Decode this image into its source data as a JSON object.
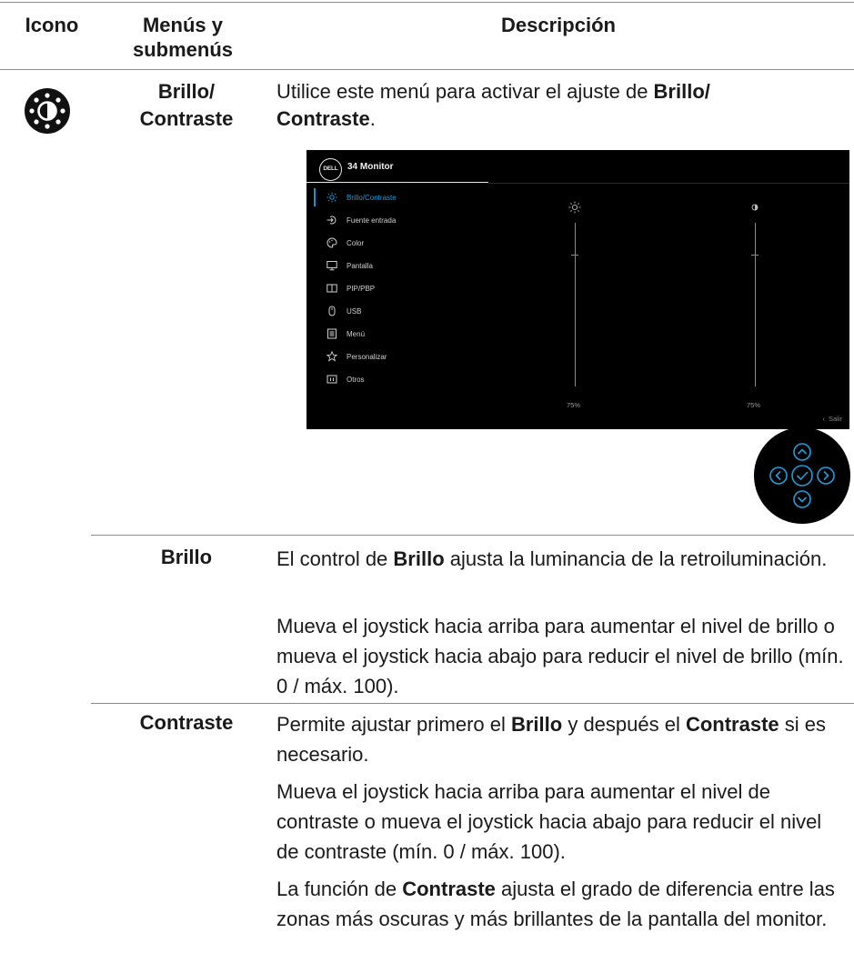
{
  "header": {
    "icon_col": "Icono",
    "menu_col_line1": "Menús y",
    "menu_col_line2": "submenús",
    "desc_col": "Descripción"
  },
  "section": {
    "icon": "brightness-contrast-icon",
    "menu_line1": "Brillo/",
    "menu_line2": "Contraste",
    "intro_pre": "Utilice este menú para activar el ajuste de ",
    "intro_bold1": "Brillo/",
    "intro_bold2": "Contraste",
    "intro_post": "."
  },
  "osd": {
    "logo": "DELL",
    "title": "34 Monitor",
    "items": [
      {
        "label": "Brillo/Contraste",
        "icon": "sun-icon",
        "active": true
      },
      {
        "label": "Fuente entrada",
        "icon": "input-source-icon"
      },
      {
        "label": "Color",
        "icon": "palette-icon"
      },
      {
        "label": "Pantalla",
        "icon": "monitor-icon"
      },
      {
        "label": "PIP/PBP",
        "icon": "pip-icon"
      },
      {
        "label": "USB",
        "icon": "mouse-icon"
      },
      {
        "label": "Menú",
        "icon": "menu-list-icon"
      },
      {
        "label": "Personalizar",
        "icon": "star-icon"
      },
      {
        "label": "Otros",
        "icon": "info-icon"
      }
    ],
    "brightness_value": "75%",
    "contrast_value": "75%",
    "brightness_level": 0.75,
    "contrast_level": 0.75,
    "exit_label": "Salir",
    "accent": "#1a9ee0"
  },
  "joystick": {
    "icons": [
      "up-arrow-icon",
      "left-arrow-icon",
      "check-icon",
      "right-arrow-icon",
      "down-arrow-icon"
    ],
    "color": "#1a9ee0"
  },
  "brillo": {
    "name": "Brillo",
    "p1_pre": "El control de ",
    "p1_bold": "Brillo",
    "p1_post": " ajusta la luminancia de la retroiluminación.",
    "p2": "Mueva el joystick hacia arriba para aumentar el nivel de brillo o mueva el joystick hacia abajo para reducir el nivel de brillo (mín. 0 / máx. 100)."
  },
  "contraste": {
    "name": "Contraste",
    "p1_pre": "Permite ajustar primero el ",
    "p1_bold1": "Brillo",
    "p1_mid": " y después el ",
    "p1_bold2": "Contraste",
    "p1_post": " si es necesario.",
    "p2": "Mueva el joystick hacia arriba para aumentar el nivel de contraste o mueva el joystick hacia abajo para reducir el nivel de contraste (mín. 0 / máx. 100).",
    "p3_pre": "La función de ",
    "p3_bold": "Contraste",
    "p3_post": " ajusta el grado de diferencia entre las zonas más oscuras y más brillantes de la pantalla del monitor."
  }
}
